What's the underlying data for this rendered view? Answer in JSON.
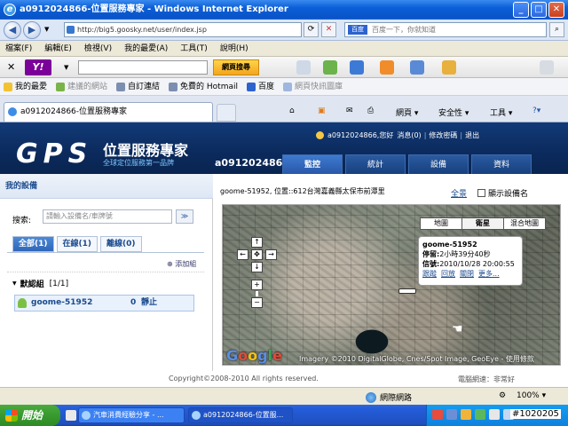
{
  "window": {
    "title": "a0912024866-位置服務專家 - Windows Internet Explorer",
    "minimize": "_",
    "maximize": "□",
    "close": "✕"
  },
  "address": {
    "url": "http://big5.goosky.net/user/index.jsp",
    "search_placeholder": "百度一下，你就知道",
    "search_brand": "百度"
  },
  "menu": [
    "檔案(F)",
    "編輯(E)",
    "檢視(V)",
    "我的最愛(A)",
    "工具(T)",
    "說明(H)"
  ],
  "yahoo": {
    "logo": "Y!",
    "search_button": "網頁搜尋"
  },
  "favorites": {
    "label": "我的最愛",
    "items": [
      "建議的網站",
      "自訂連結",
      "免費的 Hotmail",
      "百度",
      "網頁快訊圖庫"
    ]
  },
  "tabs": {
    "active": "a0912024866-位置服務專家",
    "commands": [
      "網頁",
      "安全性",
      "工具"
    ]
  },
  "app": {
    "logo": "GPS",
    "brand_title": "位置服務專家",
    "brand_sub": "全球定位服務第一品牌",
    "account": "a0912024866",
    "user_menu": [
      "a0912024866,您好",
      "消息(0)",
      "修改密碼",
      "退出"
    ],
    "nav": [
      "監控",
      "統計",
      "設備",
      "資料"
    ]
  },
  "sidebar": {
    "title": "我的設備",
    "search_label": "搜索:",
    "search_placeholder": "請輸入設備名/車牌號",
    "filters": [
      "全部(1)",
      "在線(1)",
      "離線(0)"
    ],
    "add_group": "添加組",
    "group": {
      "name": "默認組",
      "count": "[1/1]"
    },
    "device": {
      "name": "goome-51952",
      "count": "0",
      "status": "靜止"
    }
  },
  "map": {
    "location": "goome-51952, 位置::612台灣嘉義縣太保市前潭里",
    "zoom_all": "全景",
    "show_names": "顯示設備名",
    "types": [
      "地圖",
      "衛星",
      "混合地圖"
    ],
    "active_type": "衛星",
    "info": {
      "name": "goome-51952",
      "stopped_label": "停留:",
      "stopped": "2小時39分40秒",
      "signal_label": "信號:",
      "signal": "2010/10/28 20:00:55",
      "links": [
        "跟蹤",
        "回放",
        "關閉",
        "更多..."
      ]
    },
    "google": "Google",
    "copyright": "Imagery ©2010 DigitalGlobe, Cnes/Spot Image, GeoEye - 使用條款"
  },
  "footer": {
    "copyright": "Copyright©2008-2010 All rights reserved.",
    "speed": "電腦網速：非常好"
  },
  "status": {
    "zone": "網際網路",
    "zoom": "100%"
  },
  "taskbar": {
    "start": "開始",
    "items": [
      "汽車消費經驗分享 - ...",
      "a0912024866-位置服..."
    ],
    "clock": "#1020205"
  }
}
